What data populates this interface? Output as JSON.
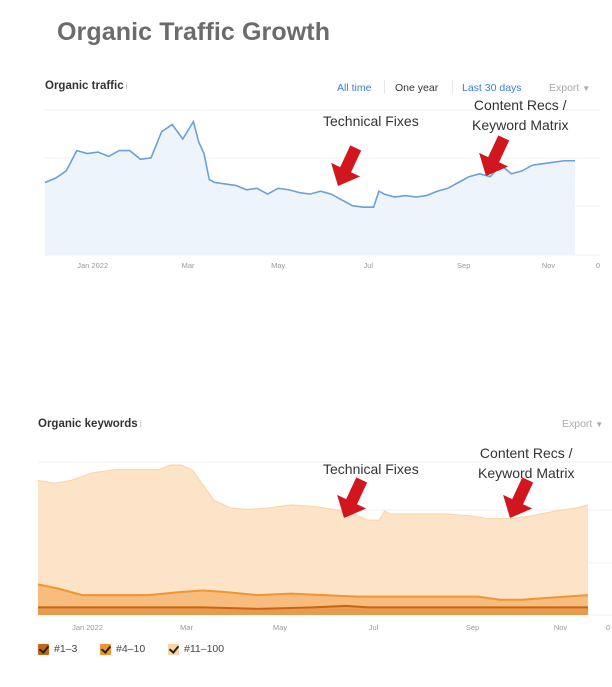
{
  "page": {
    "title": "Organic Traffic Growth"
  },
  "traffic_panel": {
    "label": "Organic traffic",
    "info_icon": "info-icon",
    "ranges": [
      "All time",
      "One year",
      "Last 30 days"
    ],
    "export_label": "Export",
    "export_icon": "caret-down-icon",
    "annotations": [
      {
        "text": "Technical Fixes"
      },
      {
        "text": "Content Recs /\nKeyword Matrix"
      }
    ]
  },
  "keywords_panel": {
    "label": "Organic keywords",
    "info_icon": "info-icon",
    "export_label": "Export",
    "export_icon": "caret-down-icon",
    "annotations": [
      {
        "text": "Technical Fixes"
      },
      {
        "text": "Content Recs /\nKeyword Matrix"
      }
    ],
    "legend": [
      {
        "label": "#1–3",
        "color": "#c8650f",
        "checked": true
      },
      {
        "label": "#4–10",
        "color": "#f09530",
        "checked": true
      },
      {
        "label": "#11–100",
        "color": "#fcd3a4",
        "checked": true
      }
    ]
  },
  "chart_data": [
    {
      "type": "area",
      "title": "Organic traffic",
      "x_tick_labels": [
        "Jan 2022",
        "Mar",
        "May",
        "Jul",
        "Sep",
        "Nov"
      ],
      "right_axis_label": "0",
      "grid": true,
      "color": "#6aa1d6",
      "fill": "#eef4fc",
      "x": [
        0,
        2,
        4,
        6,
        8,
        10,
        12,
        14,
        16,
        18,
        20,
        22,
        24,
        26,
        28,
        29,
        30,
        31,
        32,
        34,
        36,
        38,
        40,
        42,
        44,
        46,
        48,
        50,
        52,
        54,
        56,
        58,
        60,
        62,
        63,
        64,
        66,
        68,
        70,
        72,
        74,
        76,
        78,
        80,
        82,
        84,
        86,
        88,
        90,
        92,
        94,
        96,
        98,
        100
      ],
      "values": [
        0.5,
        0.53,
        0.58,
        0.72,
        0.7,
        0.71,
        0.68,
        0.72,
        0.72,
        0.66,
        0.67,
        0.85,
        0.9,
        0.8,
        0.92,
        0.78,
        0.7,
        0.52,
        0.5,
        0.49,
        0.48,
        0.45,
        0.46,
        0.42,
        0.46,
        0.45,
        0.43,
        0.42,
        0.44,
        0.42,
        0.38,
        0.34,
        0.33,
        0.33,
        0.44,
        0.42,
        0.4,
        0.41,
        0.4,
        0.41,
        0.44,
        0.46,
        0.5,
        0.54,
        0.56,
        0.54,
        0.62,
        0.56,
        0.58,
        0.62,
        0.63,
        0.64,
        0.65,
        0.65
      ],
      "ylim": [
        0,
        1
      ],
      "annotations": [
        {
          "label": "Technical Fixes",
          "x": 56
        },
        {
          "label": "Content Recs / Keyword Matrix",
          "x": 87
        }
      ]
    },
    {
      "type": "area",
      "title": "Organic keywords",
      "x_tick_labels": [
        "Jan 2022",
        "Mar",
        "May",
        "Jul",
        "Sep",
        "Nov"
      ],
      "right_axis_label": "0",
      "grid": true,
      "stacked": true,
      "series": [
        {
          "name": "#11–100",
          "color": "#fcd3a4",
          "x": [
            0,
            3,
            6,
            10,
            14,
            18,
            22,
            24,
            26,
            28,
            30,
            32,
            35,
            38,
            42,
            46,
            50,
            54,
            56,
            58,
            60,
            62,
            63,
            64,
            66,
            70,
            74,
            78,
            82,
            86,
            90,
            94,
            98,
            100
          ],
          "values": [
            0.88,
            0.86,
            0.88,
            0.93,
            0.95,
            0.95,
            0.95,
            0.98,
            0.98,
            0.95,
            0.85,
            0.75,
            0.7,
            0.69,
            0.7,
            0.72,
            0.71,
            0.69,
            0.67,
            0.65,
            0.62,
            0.62,
            0.68,
            0.66,
            0.66,
            0.66,
            0.66,
            0.65,
            0.63,
            0.63,
            0.65,
            0.68,
            0.7,
            0.72
          ]
        },
        {
          "name": "#4–10",
          "color": "#f09530",
          "x": [
            0,
            4,
            8,
            14,
            20,
            26,
            30,
            34,
            40,
            46,
            52,
            58,
            64,
            70,
            76,
            80,
            84,
            88,
            92,
            96,
            100
          ],
          "values": [
            0.2,
            0.17,
            0.13,
            0.13,
            0.13,
            0.15,
            0.16,
            0.15,
            0.13,
            0.14,
            0.13,
            0.12,
            0.12,
            0.12,
            0.12,
            0.12,
            0.1,
            0.1,
            0.11,
            0.12,
            0.13
          ]
        },
        {
          "name": "#1–3",
          "color": "#c8650f",
          "x": [
            0,
            10,
            20,
            30,
            40,
            50,
            56,
            60,
            70,
            80,
            90,
            100
          ],
          "values": [
            0.05,
            0.05,
            0.05,
            0.05,
            0.04,
            0.05,
            0.06,
            0.05,
            0.05,
            0.05,
            0.05,
            0.05
          ]
        }
      ],
      "ylim": [
        0,
        1
      ],
      "annotations": [
        {
          "label": "Technical Fixes",
          "x": 57
        },
        {
          "label": "Content Recs / Keyword Matrix",
          "x": 88
        }
      ]
    }
  ]
}
